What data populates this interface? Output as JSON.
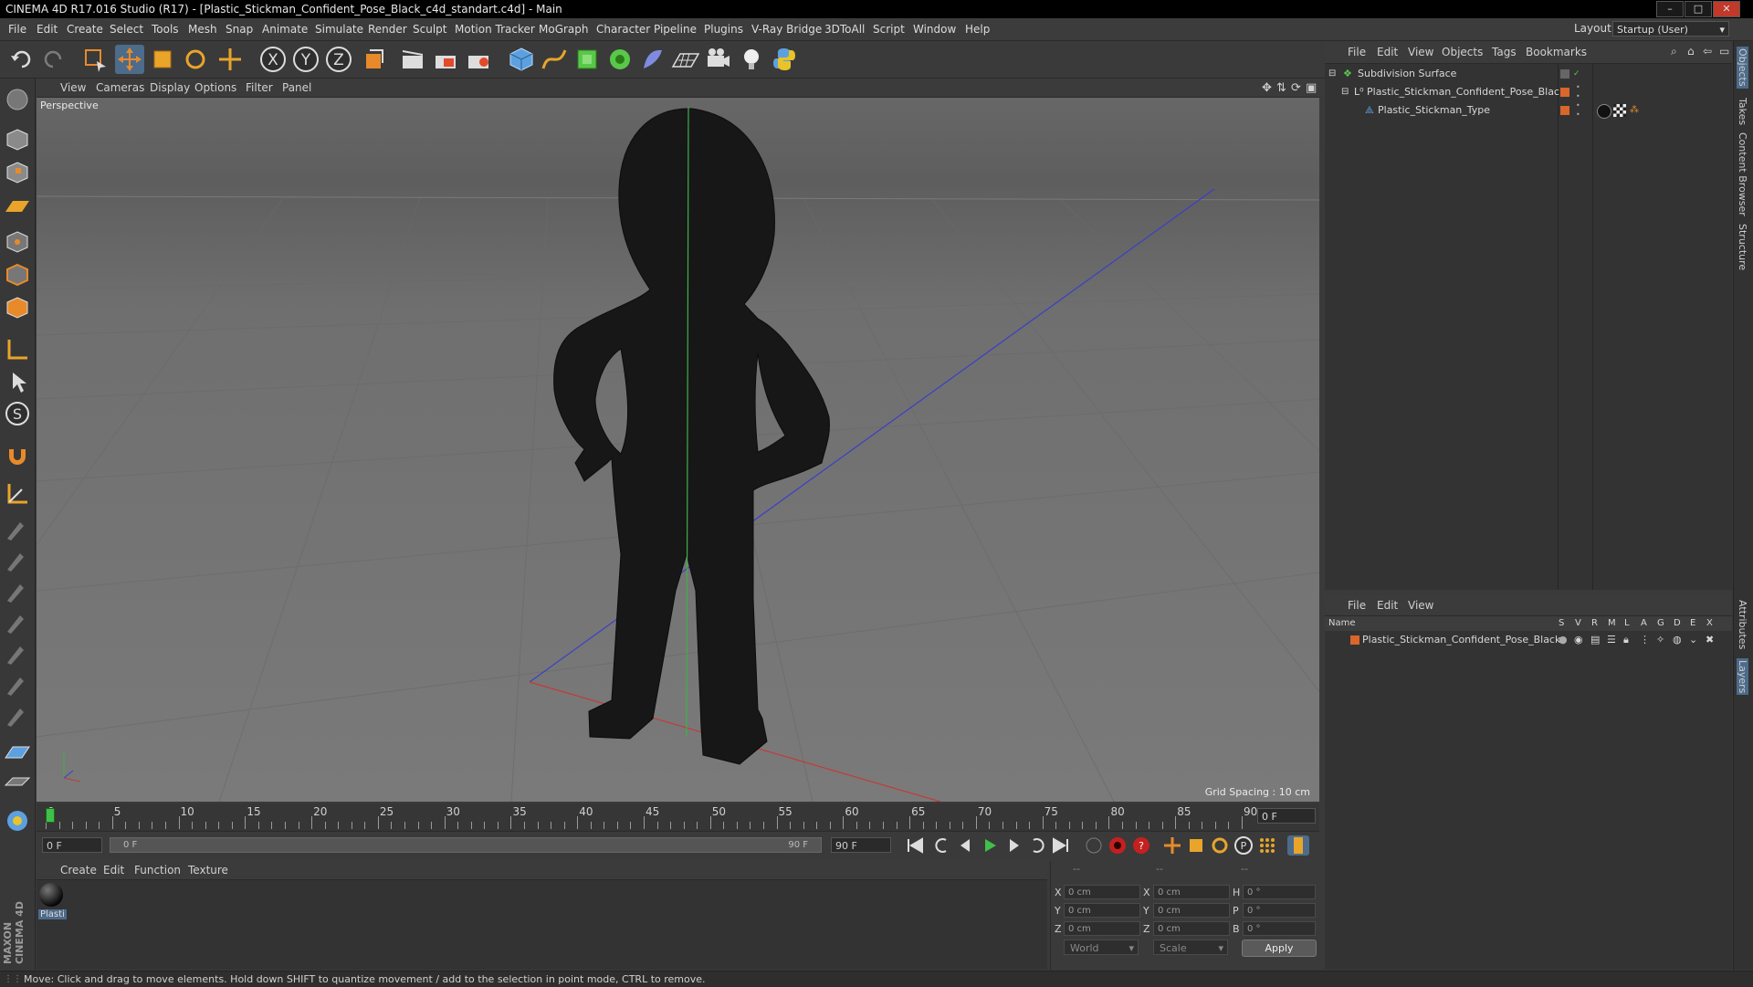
{
  "window": {
    "title": "CINEMA 4D R17.016 Studio (R17) - [Plastic_Stickman_Confident_Pose_Black_c4d_standart.c4d] - Main"
  },
  "menu": [
    "File",
    "Edit",
    "Create",
    "Select",
    "Tools",
    "Mesh",
    "Snap",
    "Animate",
    "Simulate",
    "Render",
    "Sculpt",
    "Motion Tracker",
    "MoGraph",
    "Character",
    "Pipeline",
    "Plugins",
    "V-Ray Bridge",
    "3DToAll",
    "Script",
    "Window",
    "Help"
  ],
  "layout": {
    "label": "Layout:",
    "value": "Startup (User)"
  },
  "viewport": {
    "menu": [
      "View",
      "Cameras",
      "Display",
      "Options",
      "Filter",
      "Panel"
    ],
    "camera_label": "Perspective",
    "grid_spacing": "Grid Spacing : 10 cm"
  },
  "timeline": {
    "ticks": [
      "0",
      "5",
      "10",
      "15",
      "20",
      "25",
      "30",
      "35",
      "40",
      "45",
      "50",
      "55",
      "60",
      "65",
      "70",
      "75",
      "80",
      "85",
      "90"
    ],
    "current_frame": "0 F"
  },
  "transport": {
    "start_field": "0 F",
    "range_start": "0 F",
    "range_end": "90 F",
    "end_field": "90 F"
  },
  "material_manager": {
    "menu": [
      "Create",
      "Edit",
      "Function",
      "Texture"
    ],
    "materials": [
      {
        "label": "Plasti"
      }
    ]
  },
  "coordinates": {
    "headers": [
      "--",
      "--",
      "--"
    ],
    "rows": [
      {
        "a": "X",
        "av": "0 cm",
        "b": "X",
        "bv": "0 cm",
        "c": "H",
        "cv": "0 °"
      },
      {
        "a": "Y",
        "av": "0 cm",
        "b": "Y",
        "bv": "0 cm",
        "c": "P",
        "cv": "0 °"
      },
      {
        "a": "Z",
        "av": "0 cm",
        "b": "Z",
        "bv": "0 cm",
        "c": "B",
        "cv": "0 °"
      }
    ],
    "mode": "World",
    "type": "Scale",
    "apply": "Apply"
  },
  "objects_manager": {
    "menu": [
      "File",
      "Edit",
      "View",
      "Objects",
      "Tags",
      "Bookmarks"
    ],
    "items": [
      {
        "name": "Subdivision Surface",
        "depth": 0
      },
      {
        "name": "Plastic_Stickman_Confident_Pose_Black",
        "depth": 1
      },
      {
        "name": "Plastic_Stickman_Type",
        "depth": 2
      }
    ]
  },
  "layer_manager": {
    "menu": [
      "File",
      "Edit",
      "View"
    ],
    "columns": [
      "Name",
      "S",
      "V",
      "R",
      "M",
      "L",
      "A",
      "G",
      "D",
      "E",
      "X"
    ],
    "layers": [
      {
        "name": "Plastic_Stickman_Confident_Pose_Black",
        "color": "#d9662b"
      }
    ]
  },
  "right_tabs": [
    "Objects",
    "Takes",
    "Content Browser",
    "Structure",
    "Attributes",
    "Layers"
  ],
  "status": "Move: Click and drag to move elements. Hold down SHIFT to quantize movement / add to the selection in point mode, CTRL to remove.",
  "brand": "MAXON CINEMA 4D",
  "colors": {
    "accent_orange": "#e88a2a",
    "accent_blue": "#5da0e0",
    "layer_orange": "#d9662b",
    "active_green": "#59c84a"
  }
}
